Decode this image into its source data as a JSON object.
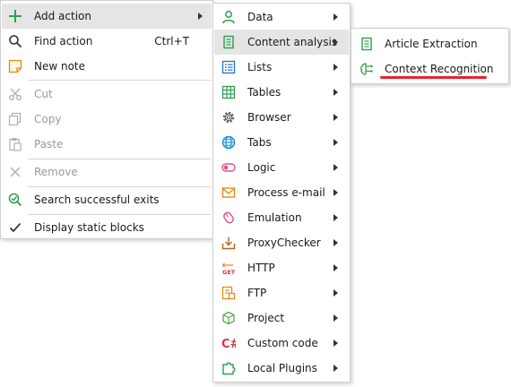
{
  "main_menu": {
    "add_action": "Add action",
    "find_action": "Find action",
    "find_action_shortcut": "Ctrl+T",
    "new_note": "New note",
    "cut": "Cut",
    "copy": "Copy",
    "paste": "Paste",
    "remove": "Remove",
    "search_successful_exits": "Search successful exits",
    "display_static_blocks": "Display static blocks"
  },
  "action_menu": {
    "data": "Data",
    "content_analysis": "Content analysis",
    "lists": "Lists",
    "tables": "Tables",
    "browser": "Browser",
    "tabs": "Tabs",
    "logic": "Logic",
    "process_email": "Process e-mail",
    "emulation": "Emulation",
    "proxy_checker": "ProxyChecker",
    "http": "HTTP",
    "ftp": "FTP",
    "project": "Project",
    "custom_code": "Custom code",
    "local_plugins": "Local Plugins"
  },
  "content_analysis_menu": {
    "article_extraction": "Article Extraction",
    "context_recognition": "Context Recognition"
  },
  "icons": {
    "add": "plus-icon",
    "find": "search-icon",
    "note": "note-icon",
    "cut": "scissors-icon",
    "copy": "copy-icon",
    "paste": "paste-icon",
    "remove": "x-icon",
    "search_exits": "search-check-icon",
    "check": "checkmark-icon",
    "data": "user-icon",
    "content_analysis": "document-icon",
    "lists": "list-icon",
    "tables": "table-icon",
    "browser": "gear-icon",
    "tabs": "globe-icon",
    "logic": "toggle-icon",
    "email": "envelope-icon",
    "emulation": "mouse-icon",
    "proxy": "download-icon",
    "http": "get-icon",
    "ftp": "ftp-icon",
    "project": "cube-icon",
    "custom_code": "csharp-icon",
    "local_plugins": "puzzle-icon",
    "context": "brain-icon"
  },
  "colors": {
    "green": "#2e9e4f",
    "blue": "#1f73c9",
    "orange": "#e58a16",
    "red": "#e0313f",
    "highlight": "#e5e5e5",
    "underline": "#e8232b",
    "pink": "#e04f8a"
  }
}
